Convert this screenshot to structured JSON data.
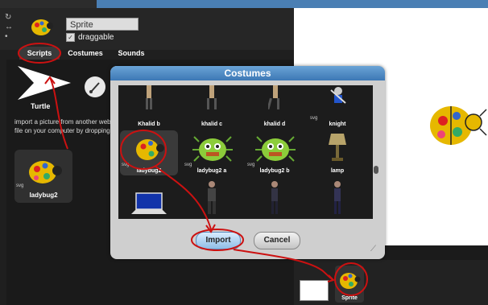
{
  "sprite": {
    "name": "Sprite",
    "draggable_label": "draggable",
    "draggable_checked": true
  },
  "tabs": [
    {
      "label": "Scripts"
    },
    {
      "label": "Costumes"
    },
    {
      "label": "Sounds"
    }
  ],
  "left_panel": {
    "turtle_label": "Turtle",
    "import_text": "import a picture from another web p… a file on your computer by dropping…",
    "costume_thumb": {
      "label": "ladybug2",
      "tag": "svg"
    }
  },
  "dialog": {
    "title": "Costumes",
    "items": [
      {
        "label": "Khalid b",
        "tag": ""
      },
      {
        "label": "khalid c",
        "tag": ""
      },
      {
        "label": "khalid d",
        "tag": ""
      },
      {
        "label": "knight",
        "tag": "svg"
      },
      {
        "label": "ladybug2",
        "tag": "svg"
      },
      {
        "label": "ladybug2 a",
        "tag": "svg"
      },
      {
        "label": "ladybug2 b",
        "tag": "svg"
      },
      {
        "label": "lamp",
        "tag": ""
      }
    ],
    "import_label": "Import",
    "cancel_label": "Cancel"
  },
  "corral": {
    "sprite_label": "Sprite"
  },
  "colors": {
    "accent": "#4a7fb4",
    "annotation": "#cc1111",
    "ladybug_body": "#e6b800"
  },
  "icons": [
    "turtle-arrow-icon",
    "paintbrush-icon",
    "rotation-style-icons",
    "resize-handle-icon"
  ]
}
